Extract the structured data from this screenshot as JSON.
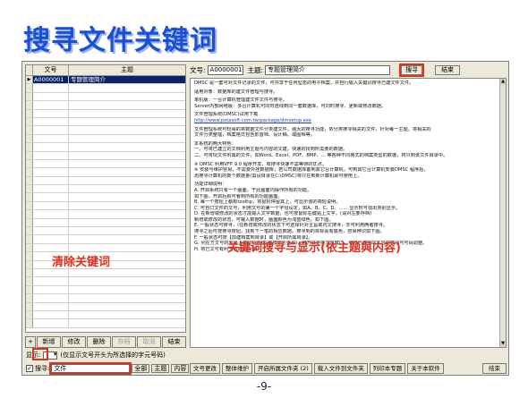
{
  "slide": {
    "title": "搜寻文件关键词",
    "page_number": "-9-",
    "annotation_clear": "清除关键词",
    "annotation_search": "关键词搜寻与显示(依主题與内容)"
  },
  "grid": {
    "col_no": "文号",
    "col_subject": "主题",
    "selected_marker": "▶",
    "rows": [
      {
        "no": "A0000001",
        "subject": "专题管理简介"
      }
    ]
  },
  "left_buttons": [
    "+",
    "新增",
    "修改",
    "删除",
    "存档",
    "取消",
    "结束"
  ],
  "display": {
    "label": "显示:",
    "hint": "(仅显示文号开头为所选择的字元号码)"
  },
  "search": {
    "label": "搜寻:",
    "value": "文件",
    "btn_all": "全部",
    "btn_subject": "主题",
    "btn_content": "内容"
  },
  "topbar": {
    "no_label": "文号:",
    "no_value": "A0000001",
    "subject_label": "主题:",
    "subject_value": "专题管理简介",
    "search_btn": "搜寻",
    "close_btn": "结束"
  },
  "content_lines": [
    "DMSC 是一套可对文件记录的文件，可共享于任何型态的电子档案，并自行输入关键词搜寻已建文件文件。",
    "适用对象：数据库的建文件管理与搜寻。",
    "单机版：一台计算机管理建文件文件与搜寻。",
    "Server内部网络版：多台计算机可同时连线到同一套数据库，可同时搜寻、更新或修改数据。",
    "文件管理系统(DMSC)试用下载",
    "http://www.potasoft.com.tw/package/dmsetup.exe",
    "文件管理系统可轻易的将数据文件分类建文件。强大的搜寻功能，依分类搜寻相关的文件，针对每一主题，将相关的",
    "文件分类整理，档案格式包含影音档、设计稿、或图档等。",
    "本系统的两大特色：",
    "一、可将已建立的文档利用主题与内容的文建，快速的找到所需要的数据。",
    "二、可将现文件附属的文件，如Word、Excel、PDF、BMP、... 等各种不同格式的档案类型的数据，将只到该文件目录中。",
    "※ DMSC 利用VFP 9.0 程序开发，有搜寻快速不需等待的优点。",
    "※ 安装与维护容易，不需要外挂数据库；若公司数据库备到其它台计算机，可到其它台计算机安装DMSC 程序后，",
    "  再搜寻计算机的数个数据量(需设目录在C:\\DMSC)将只在到新计算机即可使用上。",
    "功能详细说明：",
    "A. 开启系统只有一个画面，于此画面内操作所有的功能。",
    "如下图，开启后就可看到所有的功能画面。",
    "B. 每一个按钮上都有tooltip，将鼠标停留其上，可显示该的简短说明。",
    "C. 可自订文件的文号，利用文号的第一个字母设定，如A、B、C、D、...... 显示时可找出类别显示。",
    "D. 在新增或修改的状态才能输入文字数据，也可按鼠标右键贴上文字。(请对左要存档)",
    "新增或修改的状态，可输入数据时，画面颜色为浅蓝绿色。如下图。",
    "E. 一般状态可搜寻，(在新增或修改的状态下可选择针对主旨或内文搜寻，亦可利用两者搜寻。",
    "搜寻之后可按搜寻按钮，找到下一笔的相应数据。搜寻到的目标会有底色，容易辨识如下图。",
    "F. 一般状态可按【加建档案到目录】或【开启所属目录】。",
    "G. 列在方文号的号码上按鼠标左键(或按文号更改)，可开启更换文号窗口，可将已建档的文号的类别与号码调整。",
    "H. 将已文号有利于数据的操作。"
  ],
  "bottom_buttons": [
    "文号更改",
    "整体维护",
    "开启所属文件夹 (2)",
    "载入文件到文件夹",
    "列印本专题",
    "关于本软件",
    "结束"
  ]
}
